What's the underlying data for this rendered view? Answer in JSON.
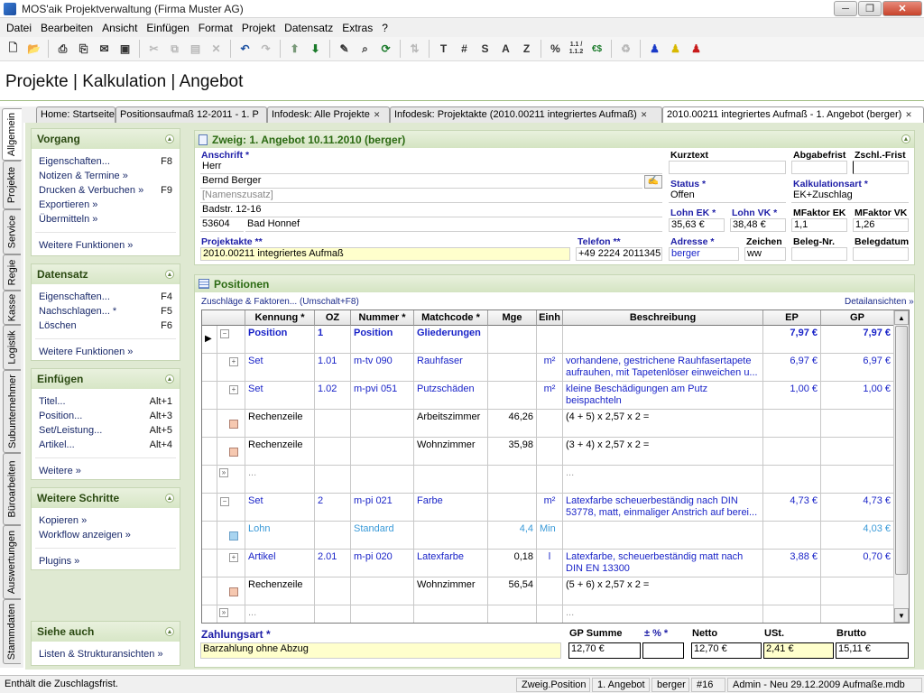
{
  "window": {
    "title": "MOS'aik Projektverwaltung (Firma Muster AG)",
    "minimize": "─",
    "maximize": "❐",
    "close": "✕"
  },
  "menu": [
    "Datei",
    "Bearbeiten",
    "Ansicht",
    "Einfügen",
    "Format",
    "Projekt",
    "Datensatz",
    "Extras",
    "?"
  ],
  "toolbar_icons": [
    "new-document-icon",
    "open-folder-icon",
    "print-icon",
    "print-preview-icon",
    "email-icon",
    "save-icon",
    "cut-icon",
    "copy-icon",
    "paste-icon",
    "delete-icon",
    "undo-icon",
    "redo-icon",
    "move-up-icon",
    "move-down-icon",
    "edit-pencil-icon",
    "search-icon",
    "refresh-icon",
    "sort-icon",
    "T",
    "#",
    "S",
    "A",
    "Z",
    "%",
    "1.1 / 1.1.2",
    "€$",
    "recycle-icon",
    "user-blue-icon",
    "user-yellow-icon",
    "user-red-icon"
  ],
  "header": {
    "title": "Projekte | Kalkulation | Angebot"
  },
  "vtabs": [
    "Allgemein",
    "Projekte",
    "Service",
    "Regie",
    "Kasse",
    "Logistik",
    "Subunternehmer",
    "Büroarbeiten",
    "Auswertungen",
    "Stammdaten"
  ],
  "doctabs": [
    "Home: Startseite",
    "Positionsaufmaß 12-2011 - 1. P",
    "Infodesk: Alle Projekte",
    "Infodesk: Projektakte (2010.00211 integriertes Aufmaß)",
    "2010.00211 integriertes Aufmaß - 1. Angebot (berger)"
  ],
  "left": {
    "vorgang": {
      "title": "Vorgang",
      "items": [
        [
          "Eigenschaften...",
          "F8"
        ],
        [
          "Notizen & Termine »",
          ""
        ],
        [
          "Drucken & Verbuchen »",
          "F9"
        ],
        [
          "Exportieren »",
          ""
        ],
        [
          "Übermitteln »",
          ""
        ]
      ],
      "more": "Weitere Funktionen »"
    },
    "datensatz": {
      "title": "Datensatz",
      "items": [
        [
          "Eigenschaften...",
          "F4"
        ],
        [
          "Nachschlagen... *",
          "F5"
        ],
        [
          "Löschen",
          "F6"
        ]
      ],
      "more": "Weitere Funktionen »"
    },
    "einfuegen": {
      "title": "Einfügen",
      "items": [
        [
          "Titel...",
          "Alt+1"
        ],
        [
          "Position...",
          "Alt+3"
        ],
        [
          "Set/Leistung...",
          "Alt+5"
        ],
        [
          "Artikel...",
          "Alt+4"
        ]
      ],
      "more": "Weitere »"
    },
    "schritte": {
      "title": "Weitere Schritte",
      "items": [
        "Kopieren »",
        "Workflow anzeigen »"
      ],
      "more": "Plugins »"
    },
    "siehe": {
      "title": "Siehe auch",
      "items": [
        "Listen & Strukturansichten »"
      ]
    }
  },
  "zweig": {
    "title": "Zweig: 1. Angebot 10.11.2010 (berger)",
    "anschrift_label": "Anschrift *",
    "anrede": "Herr",
    "name": "Bernd Berger",
    "namenszusatz": "[Namenszusatz]",
    "strasse": "Badstr. 12-16",
    "plz": "53604",
    "ort": "Bad Honnef",
    "projektakte_label": "Projektakte **",
    "projektakte": "2010.00211 integriertes Aufmaß",
    "telefon_label": "Telefon **",
    "telefon": "+49 2224 2011345",
    "kurztext_label": "Kurztext",
    "abgabefrist_label": "Abgabefrist",
    "zschl_frist_label": "Zschl.-Frist",
    "status_label": "Status *",
    "status": "Offen",
    "kalkulationsart_label": "Kalkulationsart *",
    "kalkulationsart": "EK+Zuschlag",
    "lohn_ek_label": "Lohn EK *",
    "lohn_ek": "35,63 €",
    "lohn_vk_label": "Lohn VK *",
    "lohn_vk": "38,48 €",
    "mfaktor_ek_label": "MFaktor EK",
    "mfaktor_ek": "1,1",
    "mfaktor_vk_label": "MFaktor VK",
    "mfaktor_vk": "1,26",
    "adresse_label": "Adresse *",
    "adresse": "berger",
    "zeichen_label": "Zeichen",
    "zeichen": "ww",
    "beleg_nr_label": "Beleg-Nr.",
    "belegdatum_label": "Belegdatum"
  },
  "positionen": {
    "title": "Positionen",
    "zuschlaege_link": "Zuschläge & Faktoren... (Umschalt+F8)",
    "detail_link": "Detailansichten »",
    "columns": [
      "Kennung *",
      "OZ",
      "Nummer *",
      "Matchcode *",
      "Mge",
      "Einh",
      "Beschreibung",
      "EP",
      "GP"
    ],
    "rows": [
      {
        "kennung": "Position",
        "oz": "1",
        "nummer": "Position",
        "matchcode": "Gliederungen",
        "mge": "",
        "einh": "",
        "beschreibung": "",
        "ep": "7,97 €",
        "gp": "7,97 €"
      },
      {
        "kennung": "Set",
        "oz": "1.01",
        "nummer": "m-tv 090",
        "matchcode": "Rauhfaser",
        "mge": "",
        "einh": "m²",
        "beschreibung": "vorhandene, gestrichene Rauhfasertapete aufrauhen, mit Tapetenlöser einweichen u...",
        "ep": "6,97 €",
        "gp": "6,97 €"
      },
      {
        "kennung": "Set",
        "oz": "1.02",
        "nummer": "m-pvi 051",
        "matchcode": "Putzschäden",
        "mge": "",
        "einh": "m²",
        "beschreibung": "kleine Beschädigungen am Putz beispachteln",
        "ep": "1,00 €",
        "gp": "1,00 €"
      },
      {
        "kennung": "Rechenzeile",
        "oz": "",
        "nummer": "",
        "matchcode": "Arbeitszimmer",
        "mge": "46,26",
        "einh": "",
        "beschreibung": "(4 + 5) x 2,57 x 2 =",
        "ep": "",
        "gp": ""
      },
      {
        "kennung": "Rechenzeile",
        "oz": "",
        "nummer": "",
        "matchcode": "Wohnzimmer",
        "mge": "35,98",
        "einh": "",
        "beschreibung": "(3 + 4) x 2,57 x 2 =",
        "ep": "",
        "gp": ""
      },
      {
        "kennung": "...",
        "oz": "",
        "nummer": "",
        "matchcode": "",
        "mge": "",
        "einh": "",
        "beschreibung": "...",
        "ep": "",
        "gp": ""
      },
      {
        "kennung": "Set",
        "oz": "2",
        "nummer": "m-pi 021",
        "matchcode": "Farbe",
        "mge": "",
        "einh": "m²",
        "beschreibung": "Latexfarbe scheuerbeständig nach DIN 53778, matt, einmaliger Anstrich auf berei...",
        "ep": "4,73 €",
        "gp": "4,73 €"
      },
      {
        "kennung": "Lohn",
        "oz": "",
        "nummer": "Standard",
        "matchcode": "",
        "mge": "4,4",
        "einh": "Min",
        "beschreibung": "",
        "ep": "",
        "gp": "4,03 €"
      },
      {
        "kennung": "Artikel",
        "oz": "2.01",
        "nummer": "m-pi 020",
        "matchcode": "Latexfarbe",
        "mge": "0,18",
        "einh": "l",
        "beschreibung": "Latexfarbe, scheuerbeständig matt nach DIN EN 13300",
        "ep": "3,88 €",
        "gp": "0,70 €"
      },
      {
        "kennung": "Rechenzeile",
        "oz": "",
        "nummer": "",
        "matchcode": "Wohnzimmer",
        "mge": "56,54",
        "einh": "",
        "beschreibung": "(5 + 6) x 2,57 x 2 =",
        "ep": "",
        "gp": ""
      },
      {
        "kennung": "...",
        "oz": "",
        "nummer": "",
        "matchcode": "",
        "mge": "",
        "einh": "",
        "beschreibung": "...",
        "ep": "",
        "gp": ""
      }
    ]
  },
  "footer": {
    "zahlungsart_label": "Zahlungsart *",
    "zahlungsart": "Barzahlung ohne Abzug",
    "gp_summe_label": "GP Summe",
    "gp_summe": "12,70 €",
    "pct_label": "± % *",
    "pct": "",
    "netto_label": "Netto",
    "netto": "12,70 €",
    "ust_label": "USt.",
    "ust": "2,41 €",
    "brutto_label": "Brutto",
    "brutto": "15,11 €"
  },
  "status": {
    "message": "Enthält die Zuschlagsfrist.",
    "segments": [
      "Zweig.Position",
      "1. Angebot",
      "berger",
      "#16",
      "Admin - Neu 29.12.2009 Aufmaße.mdb"
    ]
  },
  "colors": {
    "panel_bg": "#dfe9d2",
    "header_green": "#2b6a12",
    "link_blue": "#1a2a8a",
    "value_blue": "#1a24c8",
    "highlight_yellow": "#ffffcc"
  }
}
